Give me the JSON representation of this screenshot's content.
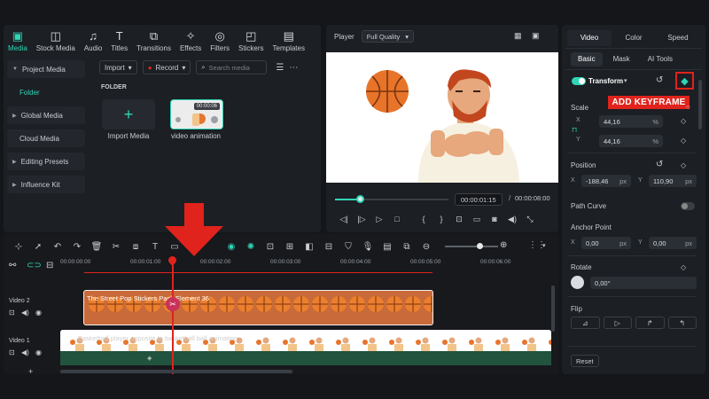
{
  "toolbar": {
    "tabs": [
      {
        "label": "Media",
        "icon": "media-icon"
      },
      {
        "label": "Stock Media",
        "icon": "stock-media-icon"
      },
      {
        "label": "Audio",
        "icon": "audio-icon"
      },
      {
        "label": "Titles",
        "icon": "titles-icon"
      },
      {
        "label": "Transitions",
        "icon": "transitions-icon"
      },
      {
        "label": "Effects",
        "icon": "effects-icon"
      },
      {
        "label": "Filters",
        "icon": "filters-icon"
      },
      {
        "label": "Stickers",
        "icon": "stickers-icon"
      },
      {
        "label": "Templates",
        "icon": "templates-icon"
      }
    ],
    "active": "Media"
  },
  "sidebar": {
    "items": [
      {
        "label": "Project Media",
        "kind": "parent"
      },
      {
        "label": "Folder",
        "kind": "child-selected"
      },
      {
        "label": "Global Media",
        "kind": "parent"
      },
      {
        "label": "Cloud Media",
        "kind": "sub"
      },
      {
        "label": "Editing Presets",
        "kind": "parent"
      },
      {
        "label": "Influence Kit",
        "kind": "parent"
      }
    ]
  },
  "media": {
    "import_label": "Import",
    "record_label": "Record",
    "search_placeholder": "Search media",
    "folder_label": "FOLDER",
    "import_media_label": "Import Media",
    "clip": {
      "name": "video animation",
      "duration": "00:00:06"
    }
  },
  "player": {
    "label": "Player",
    "quality": "Full Quality",
    "current_time": "00:00:01:15",
    "separator": "/",
    "total_time": "00:00:08:00",
    "progress": 0.18
  },
  "properties": {
    "tabs": [
      "Video",
      "Color",
      "Speed"
    ],
    "active_tab": "Video",
    "subtabs": [
      "Basic",
      "Mask",
      "AI Tools"
    ],
    "active_subtab": "Basic",
    "transform_label": "Transform",
    "annotation": "ADD KEYFRAME",
    "scale_label": "Scale",
    "scale_x_label": "X",
    "scale_x": "44,16",
    "scale_y_label": "Y",
    "scale_y": "44,16",
    "percent_unit": "%",
    "position_label": "Position",
    "pos_x_label": "X",
    "pos_x": "-188,46",
    "pos_y_label": "Y",
    "pos_y": "110,90",
    "px_unit": "px",
    "path_curve_label": "Path Curve",
    "anchor_label": "Anchor Point",
    "anchor_x_label": "X",
    "anchor_x": "0,00",
    "anchor_y_label": "Y",
    "anchor_y": "0,00",
    "rotate_label": "Rotate",
    "rotate_value": "0,00°",
    "flip_label": "Flip",
    "reset_label": "Reset"
  },
  "timeline": {
    "ruler": [
      "00:00:00:00",
      "00:00:01:00",
      "00:00:02:00",
      "00:00:03:00",
      "00:00:04:00",
      "00:00:05:00",
      "00:00:06:00"
    ],
    "tracks": [
      {
        "label": "Video 2",
        "clip_title": "The Street Pop Stickers Pack Element 36"
      },
      {
        "label": "Video 1",
        "clip_title": "Basketball player opposite to basketball ball animation"
      }
    ]
  },
  "colors": {
    "accent": "#2fd6b6",
    "annotation": "#e0231c",
    "clip_orange": "#c86a3a"
  }
}
